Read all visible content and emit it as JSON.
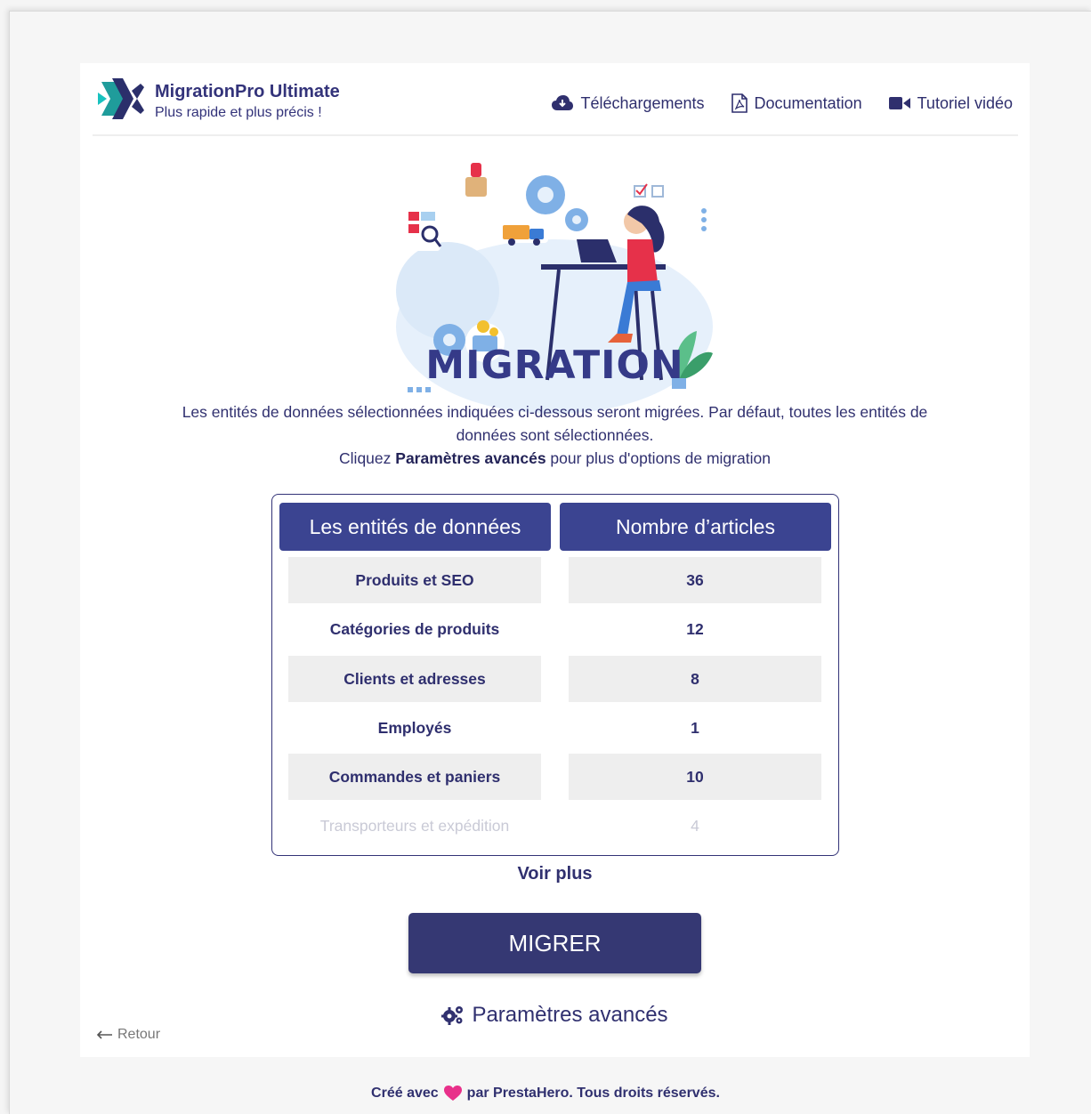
{
  "brand": {
    "title": "MigrationPro Ultimate",
    "tagline": "Plus rapide et plus précis !"
  },
  "nav": {
    "downloads": "Téléchargements",
    "documentation": "Documentation",
    "video": "Tutoriel vidéo"
  },
  "page": {
    "title": "MIGRATION",
    "desc_line1": "Les entités de données sélectionnées indiquées ci-dessous seront migrées. Par défaut, toutes les entités de données sont sélectionnées.",
    "desc_prefix": "Cliquez ",
    "desc_bold": "Paramètres avancés",
    "desc_suffix": " pour plus d'options de migration"
  },
  "table": {
    "col1": "Les entités de données",
    "col2": "Nombre d’articles",
    "rows": [
      {
        "entity": "Produits et SEO",
        "count": "36"
      },
      {
        "entity": "Catégories de produits",
        "count": "12"
      },
      {
        "entity": "Clients et adresses",
        "count": "8"
      },
      {
        "entity": "Employés",
        "count": "1"
      },
      {
        "entity": "Commandes et paniers",
        "count": "10"
      },
      {
        "entity": "Transporteurs et expédition",
        "count": "4"
      }
    ]
  },
  "actions": {
    "see_more": "Voir plus",
    "migrate": "MIGRER",
    "advanced": "Paramètres avancés",
    "back": "Retour"
  },
  "footer": {
    "prefix": "Créé avec",
    "suffix": "par PrestaHero. Tous droits réservés."
  },
  "colors": {
    "primary": "#353873",
    "header_cell": "#3b4491",
    "text": "#30306f",
    "accent_teal": "#18a7a4",
    "heart": "#e8308a"
  },
  "icons": {
    "logo": "migrationpro-logo-icon",
    "downloads": "cloud-download-icon",
    "documentation": "pdf-file-icon",
    "video": "video-camera-icon",
    "advanced": "gears-icon",
    "back": "arrow-left-icon",
    "heart": "heart-icon"
  }
}
